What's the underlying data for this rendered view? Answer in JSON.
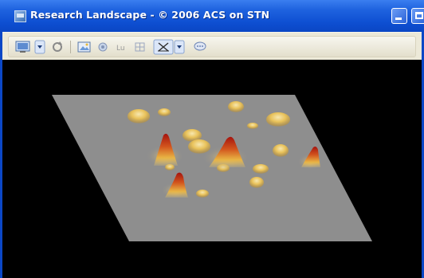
{
  "window": {
    "title": "Research Landscape - © 2006 ACS on STN",
    "app_icon": "landscape-app-icon",
    "controls": [
      "minimize-icon",
      "maximize-icon"
    ]
  },
  "toolbar": {
    "buttons": [
      {
        "name": "view-mode-button",
        "icon": "monitor-icon",
        "has_dropdown": true
      },
      {
        "name": "refresh-button",
        "icon": "refresh-icon"
      },
      {
        "name": "export-image-button",
        "icon": "image-export-icon"
      },
      {
        "name": "annotate-button",
        "icon": "annotate-icon"
      },
      {
        "name": "label-toggle-button",
        "icon": "label-icon"
      },
      {
        "name": "grid-button",
        "icon": "grid-icon"
      },
      {
        "name": "axes-mode-button",
        "icon": "axes-icon",
        "has_dropdown": true,
        "pressed": true
      },
      {
        "name": "comment-button",
        "icon": "comment-icon"
      }
    ]
  },
  "landscape": {
    "background_color": "#000000",
    "plane_color": "#8e8e8e",
    "peak_colors": [
      "#f3e2a6",
      "#e8b84a",
      "#d06a1f",
      "#b01a12"
    ]
  }
}
